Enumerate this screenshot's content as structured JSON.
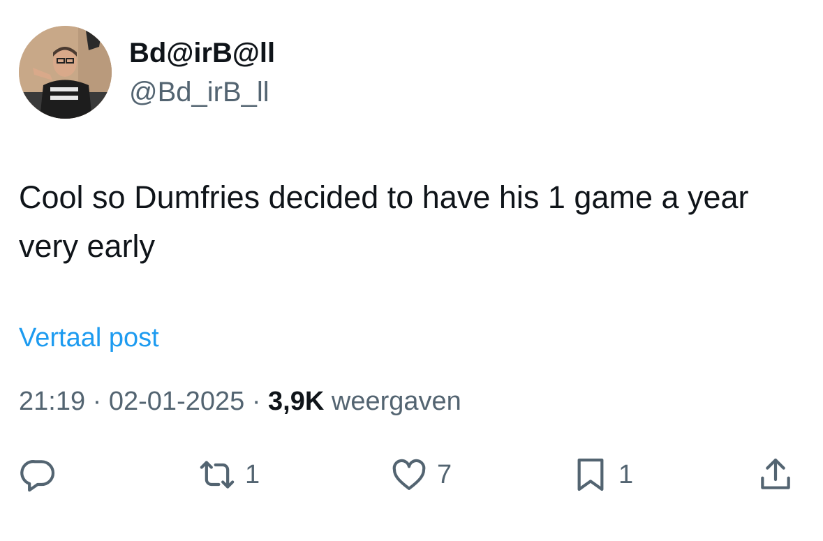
{
  "user": {
    "display_name": "Bd@irB@ll",
    "handle": "@Bd_irB_ll",
    "avatar_icon": "user-avatar"
  },
  "tweet": {
    "text": "Cool so Dumfries decided to have his 1 game a year very early",
    "translate_label": "Vertaal post",
    "time": "21:19",
    "separator": "·",
    "date": "02-01-2025",
    "views_count": "3,9K",
    "views_label": "weergaven"
  },
  "actions": {
    "reply": {
      "icon": "reply-icon",
      "count": ""
    },
    "repost": {
      "icon": "repost-icon",
      "count": "1"
    },
    "like": {
      "icon": "heart-icon",
      "count": "7"
    },
    "bookmark": {
      "icon": "bookmark-icon",
      "count": "1"
    },
    "share": {
      "icon": "share-icon",
      "count": ""
    }
  },
  "colors": {
    "text": "#0f1419",
    "secondary": "#536471",
    "link": "#1d9bf0"
  }
}
